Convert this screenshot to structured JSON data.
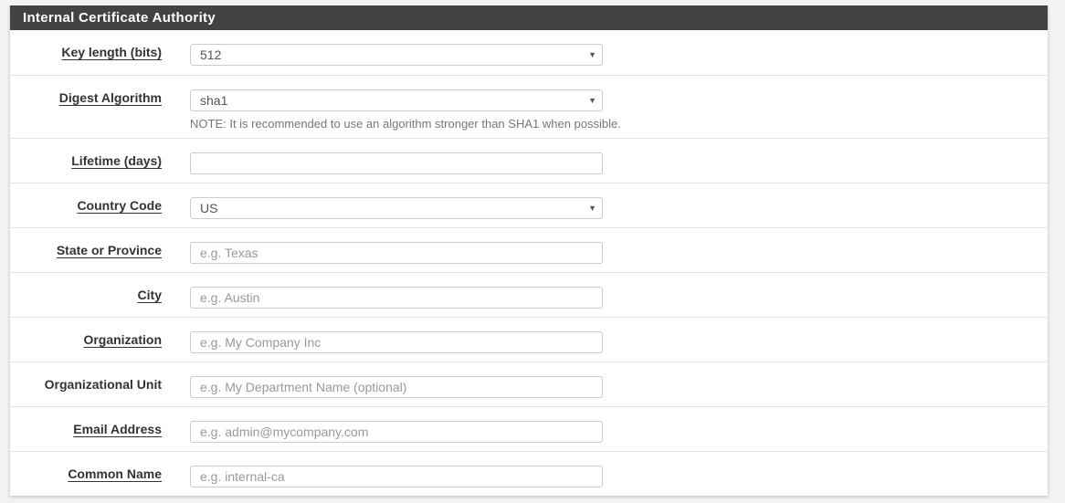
{
  "panel": {
    "title": "Internal Certificate Authority"
  },
  "fields": {
    "key_length": {
      "label": "Key length (bits)",
      "value": "512",
      "type": "select"
    },
    "digest_algorithm": {
      "label": "Digest Algorithm",
      "value": "sha1",
      "type": "select",
      "note": "NOTE: It is recommended to use an algorithm stronger than SHA1 when possible."
    },
    "lifetime": {
      "label": "Lifetime (days)",
      "value": "",
      "placeholder": ""
    },
    "country_code": {
      "label": "Country Code",
      "value": "US",
      "type": "select"
    },
    "state": {
      "label": "State or Province",
      "value": "",
      "placeholder": "e.g. Texas"
    },
    "city": {
      "label": "City",
      "value": "",
      "placeholder": "e.g. Austin"
    },
    "organization": {
      "label": "Organization",
      "value": "",
      "placeholder": "e.g. My Company Inc"
    },
    "org_unit": {
      "label": "Organizational Unit",
      "value": "",
      "placeholder": "e.g. My Department Name (optional)"
    },
    "email": {
      "label": "Email Address",
      "value": "",
      "placeholder": "e.g. admin@mycompany.com"
    },
    "common_name": {
      "label": "Common Name",
      "value": "",
      "placeholder": "e.g. internal-ca"
    }
  },
  "icons": {
    "dropdown_caret": "▼"
  }
}
